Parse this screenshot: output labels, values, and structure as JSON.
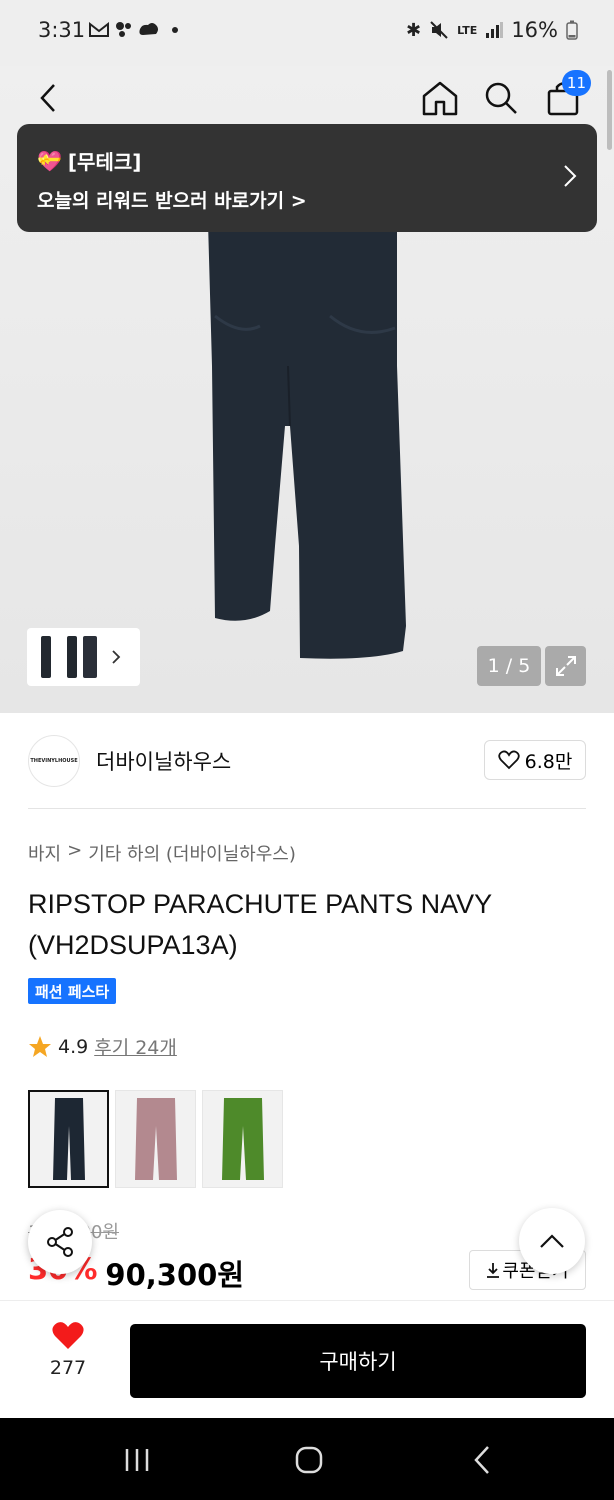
{
  "status_bar": {
    "time": "3:31",
    "battery": "16%",
    "network": "LTE"
  },
  "toolbar": {
    "cart_count": "11"
  },
  "toast": {
    "emoji": "💝",
    "title": "[무테크]",
    "body": "오늘의 리워드 받으러 바로가기 >"
  },
  "gallery": {
    "page_counter": "1 / 5"
  },
  "brand": {
    "logo_text": "THEVINYLHOUSE",
    "name": "더바이닐하우스",
    "likes": "6.8만"
  },
  "breadcrumb": {
    "category": "바지",
    "separator": ">",
    "subcategory": "기타 하의 (더바이닐하우스)"
  },
  "product": {
    "title": "RIPSTOP PARACHUTE PANTS NAVY (VH2DSUPA13A)",
    "badge": "패션 페스타",
    "rating": "4.9",
    "reviews": "후기 24개",
    "swatch_colors": [
      "#1d2733",
      "#b3898f",
      "#4e8a2a"
    ]
  },
  "price": {
    "original": "129,000원",
    "discount": "30%",
    "sale": "90,300원",
    "coupon_label": "쿠폰받기"
  },
  "bottom_bar": {
    "heart_count": "277",
    "buy_label": "구매하기"
  },
  "colors": {
    "accent_blue": "#1673ff",
    "discount_red": "#ff2b2b",
    "toast_bg": "#333333"
  }
}
